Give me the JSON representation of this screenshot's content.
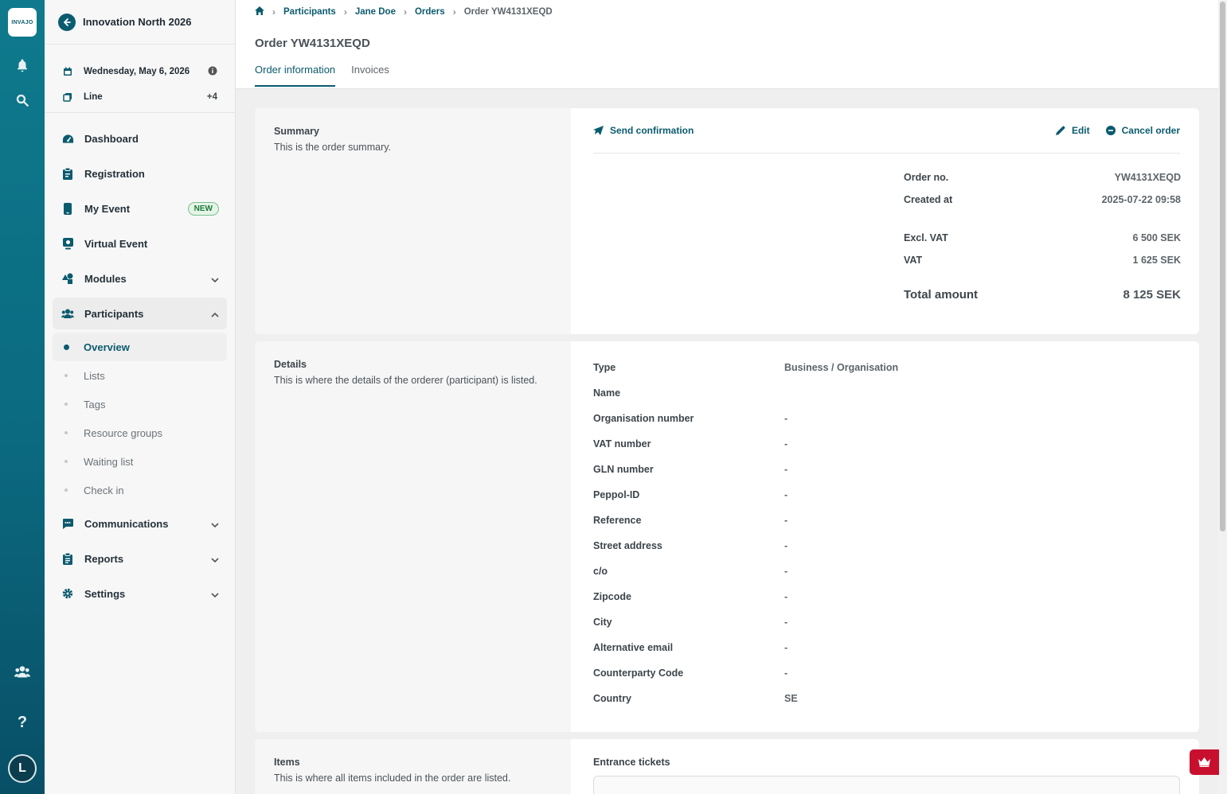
{
  "rail": {
    "logo": "INVAJO",
    "avatar_initial": "L"
  },
  "sidebar": {
    "event_title": "Innovation North 2026",
    "date": "Wednesday, May 6, 2026",
    "line_label": "Line",
    "line_count": "+4",
    "nav": [
      {
        "label": "Dashboard",
        "icon": "gauge-icon"
      },
      {
        "label": "Registration",
        "icon": "clipboard-icon"
      },
      {
        "label": "My Event",
        "icon": "phone-icon",
        "badge": "NEW"
      },
      {
        "label": "Virtual Event",
        "icon": "monitor-icon"
      },
      {
        "label": "Modules",
        "icon": "shapes-icon"
      },
      {
        "label": "Participants",
        "icon": "users-icon"
      }
    ],
    "participants_sub": [
      "Overview",
      "Lists",
      "Tags",
      "Resource groups",
      "Waiting list",
      "Check in"
    ],
    "nav_bottom": [
      {
        "label": "Communications",
        "icon": "chat-icon"
      },
      {
        "label": "Reports",
        "icon": "report-icon"
      },
      {
        "label": "Settings",
        "icon": "gear-icon"
      }
    ]
  },
  "breadcrumb": {
    "participants": "Participants",
    "person": "Jane Doe",
    "orders": "Orders",
    "current": "Order YW4131XEQD"
  },
  "page": {
    "title": "Order YW4131XEQD",
    "tabs": [
      "Order information",
      "Invoices"
    ]
  },
  "summary": {
    "heading": "Summary",
    "description": "This is the order summary.",
    "send_confirmation": "Send confirmation",
    "edit": "Edit",
    "cancel_order": "Cancel order",
    "order_no_label": "Order no.",
    "order_no": "YW4131XEQD",
    "created_label": "Created at",
    "created": "2025-07-22 09:58",
    "excl_vat_label": "Excl. VAT",
    "excl_vat": "6 500 SEK",
    "vat_label": "VAT",
    "vat": "1 625 SEK",
    "total_label": "Total amount",
    "total": "8 125 SEK"
  },
  "details": {
    "heading": "Details",
    "description": "This is where the details of the orderer (participant) is listed.",
    "rows": [
      {
        "k": "Type",
        "v": "Business / Organisation"
      },
      {
        "k": "Name",
        "v": ""
      },
      {
        "k": "Organisation number",
        "v": "-"
      },
      {
        "k": "VAT number",
        "v": "-"
      },
      {
        "k": "GLN number",
        "v": "-"
      },
      {
        "k": "Peppol-ID",
        "v": "-"
      },
      {
        "k": "Reference",
        "v": "-"
      },
      {
        "k": "Street address",
        "v": "-"
      },
      {
        "k": "c/o",
        "v": "-"
      },
      {
        "k": "Zipcode",
        "v": "-"
      },
      {
        "k": "City",
        "v": "-"
      },
      {
        "k": "Alternative email",
        "v": "-"
      },
      {
        "k": "Counterparty Code",
        "v": "-"
      },
      {
        "k": "Country",
        "v": "SE"
      }
    ]
  },
  "items": {
    "heading": "Items",
    "description": "This is where all items included in the order are listed.",
    "group": "Entrance tickets"
  }
}
